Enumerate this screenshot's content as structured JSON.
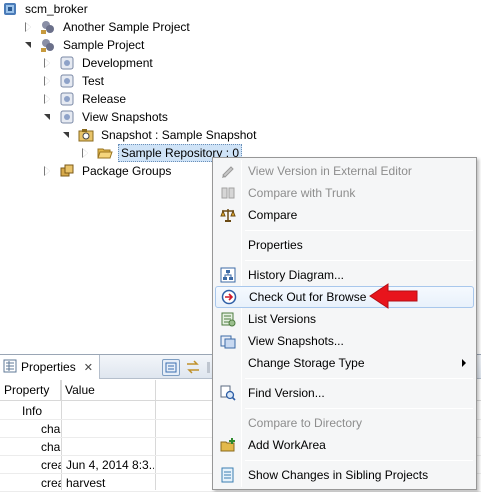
{
  "tree": {
    "root": "scm_broker",
    "items": [
      {
        "label": "Another Sample Project"
      },
      {
        "label": "Sample Project"
      },
      {
        "label": "Development"
      },
      {
        "label": "Test"
      },
      {
        "label": "Release"
      },
      {
        "label": "View Snapshots"
      },
      {
        "label": "Snapshot : Sample Snapshot"
      },
      {
        "label": "Sample Repository : 0"
      },
      {
        "label": "Package Groups"
      }
    ]
  },
  "properties": {
    "tab_label": "Properties",
    "close_glyph": "✕",
    "columns": [
      "Property",
      "Value"
    ],
    "rows": [
      {
        "property": "Info",
        "value": ""
      },
      {
        "property": "cha",
        "value": ""
      },
      {
        "property": "cha",
        "value": ""
      },
      {
        "property": "crea",
        "value": "Jun 4, 2014 8:3..."
      },
      {
        "property": "crea",
        "value": "harvest"
      }
    ]
  },
  "context_menu": {
    "items": [
      {
        "label": "View Version in External Editor",
        "disabled": true,
        "icon": "external-editor-icon"
      },
      {
        "label": "Compare with Trunk",
        "disabled": true,
        "icon": "compare-trunk-icon"
      },
      {
        "label": "Compare",
        "disabled": false,
        "icon": "scales-icon"
      },
      {
        "label": "Properties",
        "disabled": false,
        "icon": ""
      },
      {
        "label": "History Diagram...",
        "disabled": false,
        "icon": "history-diagram-icon"
      },
      {
        "label": "Check Out for Browse",
        "disabled": false,
        "icon": "checkout-browse-icon",
        "highlighted": true
      },
      {
        "label": "List Versions",
        "disabled": false,
        "icon": "list-versions-icon"
      },
      {
        "label": "View Snapshots...",
        "disabled": false,
        "icon": "view-snapshots-icon"
      },
      {
        "label": "Change Storage Type",
        "disabled": false,
        "icon": "",
        "submenu": true
      },
      {
        "label": "Find Version...",
        "disabled": false,
        "icon": "find-version-icon"
      },
      {
        "label": "Compare to Directory",
        "disabled": true,
        "icon": ""
      },
      {
        "label": "Add WorkArea",
        "disabled": false,
        "icon": "add-workarea-icon"
      },
      {
        "label": "Show Changes in Sibling Projects",
        "disabled": false,
        "icon": "sibling-changes-icon"
      }
    ]
  },
  "colors": {
    "selection": "#cfe3f7",
    "menu_hover_border": "#a8c7ec",
    "annotation_arrow": "#e8141c"
  }
}
